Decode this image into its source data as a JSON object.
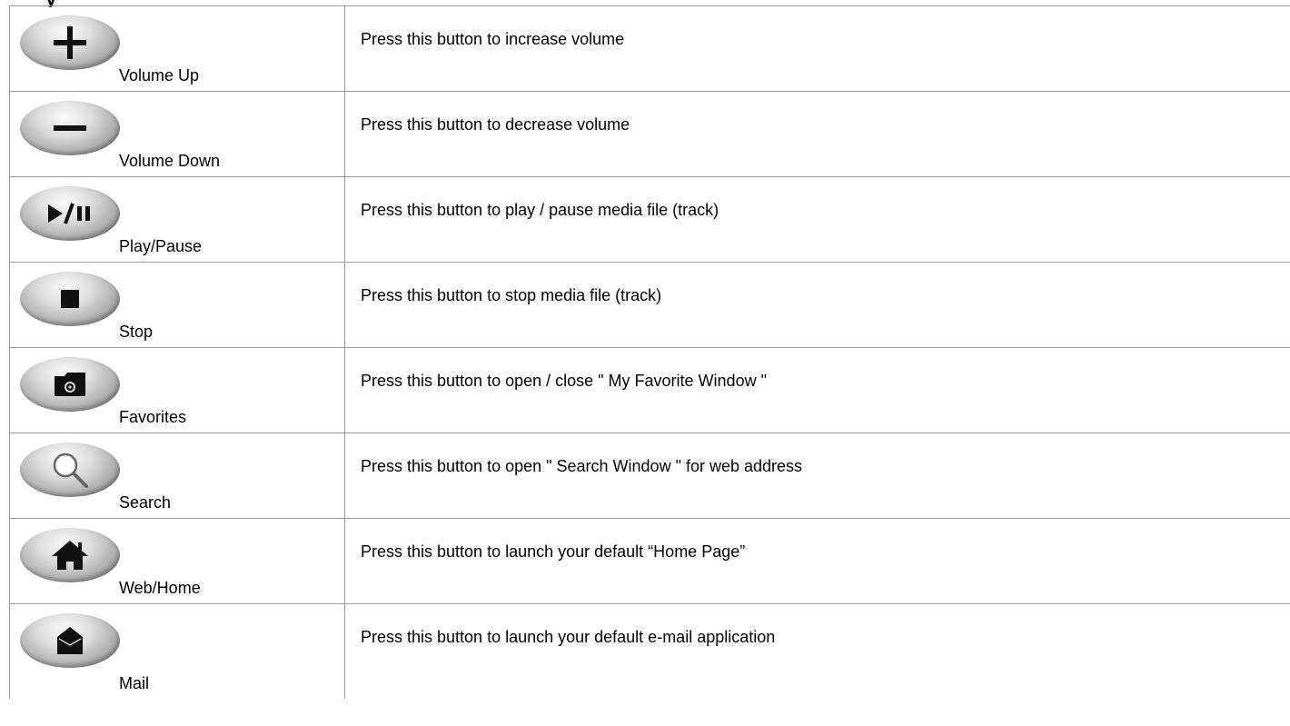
{
  "keys": [
    {
      "label": "Volume Up",
      "icon": "plus-icon",
      "description": "Press this button to increase volume"
    },
    {
      "label": "Volume Down",
      "icon": "minus-icon",
      "description": "Press this button to decrease volume"
    },
    {
      "label": "Play/Pause",
      "icon": "play-pause-icon",
      "description": "Press this button to play / pause media file (track)"
    },
    {
      "label": "Stop",
      "icon": "stop-icon",
      "description": "Press this button to stop media file (track)"
    },
    {
      "label": "Favorites",
      "icon": "folder-favorites-icon",
      "description": "Press this button to open / close \" My Favorite Window \""
    },
    {
      "label": "Search",
      "icon": "magnifier-icon",
      "description": "Press this button to open \" Search Window \" for web address"
    },
    {
      "label": "Web/Home",
      "icon": "home-icon",
      "description": "Press this button to launch your default “Home Page”"
    },
    {
      "label": "Mail",
      "icon": "mail-icon",
      "description": "Press this button to launch your default e-mail application"
    }
  ]
}
